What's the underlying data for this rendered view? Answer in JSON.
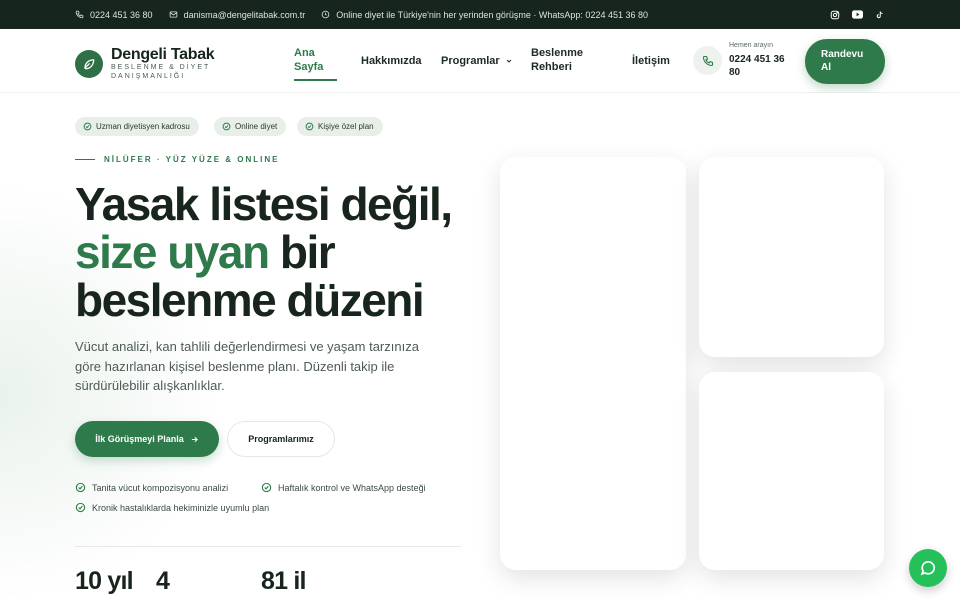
{
  "topbar": {
    "phone": "0224 451 36 80",
    "email": "danisma@dengelitabak.com.tr",
    "notice": "Online diyet ile Türkiye'nin her yerinden görüşme · WhatsApp: 0224 451 36 80",
    "social": [
      "instagram-icon",
      "youtube-icon",
      "tiktok-icon"
    ]
  },
  "header": {
    "brand_name": "Dengeli Tabak",
    "brand_tagline": "BESLENME & DİYET DANIŞMANLIĞI",
    "nav": [
      {
        "label": "Ana Sayfa",
        "active": true
      },
      {
        "label": "Hakkımızda"
      },
      {
        "label": "Programlar",
        "has_dropdown": true
      },
      {
        "label": "Beslenme Rehberi"
      },
      {
        "label": "İletişim"
      }
    ],
    "phone_label": "Hemen arayın",
    "phone_number": "0224 451 36 80",
    "cta_label": "Randevu Al"
  },
  "hero": {
    "chips": [
      "Uzman diyetisyen kadrosu",
      "Online diyet",
      "Kişiye özel plan"
    ],
    "kicker": "NİLÜFER · YÜZ YÜZE & ONLINE",
    "headline_line1": "Yasak listesi değil,",
    "headline_accent": "size uyan",
    "headline_rest": " bir",
    "headline_line3": "beslenme düzeni",
    "lead": "Vücut analizi, kan tahlili değerlendirmesi ve yaşam tarzınıza göre hazırlanan kişisel beslenme planı. Düzenli takip ile sürdürülebilir alışkanlıklar.",
    "primary_cta": "İlk Görüşmeyi Planla",
    "secondary_cta": "Programlarımız",
    "features": [
      "Tanita vücut kompozisyonu analizi",
      "Haftalık kontrol ve WhatsApp desteği",
      "Kronik hastalıklarda hekiminizle uyumlu plan"
    ],
    "stats": [
      "10 yıl",
      "4",
      "81 il"
    ]
  },
  "colors": {
    "brand_green": "#2f7a4b",
    "topbar_bg": "#16251d",
    "whatsapp_green": "#25c05a"
  }
}
